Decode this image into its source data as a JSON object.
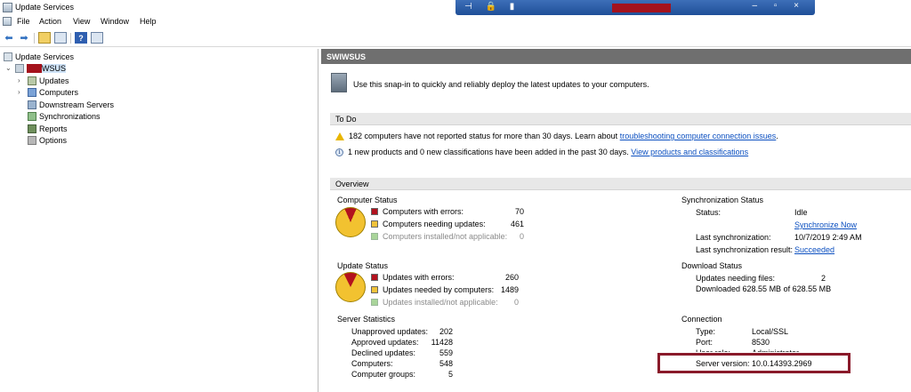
{
  "window": {
    "title": "Update Services"
  },
  "menu": [
    "File",
    "Action",
    "View",
    "Window",
    "Help"
  ],
  "tree": {
    "root": "Update Services",
    "server_suffix": "WSUS",
    "children": [
      "Updates",
      "Computers",
      "Downstream Servers",
      "Synchronizations",
      "Reports",
      "Options"
    ]
  },
  "main": {
    "header": "SWIWSUS",
    "intro": "Use this snap-in to quickly and reliably deploy the latest updates to your computers.",
    "todo": {
      "title": "To Do",
      "item1_text": "182 computers have not reported status for more than 30 days. Learn about",
      "item1_link": "troubleshooting computer connection issues",
      "item1_end": ".",
      "item2_text": "1 new products and 0 new classifications have been added in the past 30 days.",
      "item2_link": "View products and classifications"
    },
    "overview": {
      "title": "Overview",
      "computer_status": {
        "title": "Computer Status",
        "rows": [
          {
            "label": "Computers with errors:",
            "value": "70"
          },
          {
            "label": "Computers needing updates:",
            "value": "461"
          },
          {
            "label": "Computers installed/not applicable:",
            "value": "0"
          }
        ]
      },
      "update_status": {
        "title": "Update Status",
        "rows": [
          {
            "label": "Updates with errors:",
            "value": "260"
          },
          {
            "label": "Updates needed by computers:",
            "value": "1489"
          },
          {
            "label": "Updates installed/not applicable:",
            "value": "0"
          }
        ]
      },
      "server_statistics": {
        "title": "Server Statistics",
        "rows": [
          {
            "label": "Unapproved updates:",
            "value": "202"
          },
          {
            "label": "Approved updates:",
            "value": "11428"
          },
          {
            "label": "Declined updates:",
            "value": "559"
          },
          {
            "label": "Computers:",
            "value": "548"
          },
          {
            "label": "Computer groups:",
            "value": "5"
          }
        ]
      },
      "sync_status": {
        "title": "Synchronization Status",
        "status_label": "Status:",
        "status_value": "Idle",
        "sync_now": "Synchronize Now",
        "last_sync_label": "Last synchronization:",
        "last_sync_value": "10/7/2019 2:49 AM",
        "last_result_label": "Last synchronization result:",
        "last_result_value": "Succeeded"
      },
      "download_status": {
        "title": "Download Status",
        "files_label": "Updates needing files:",
        "files_value": "2",
        "downloaded": "Downloaded 628.55 MB of 628.55 MB"
      },
      "connection": {
        "title": "Connection",
        "type_label": "Type:",
        "type_value": "Local/SSL",
        "port_label": "Port:",
        "port_value": "8530",
        "user_label": "User role:",
        "user_value": "Administrator",
        "version_label": "Server version:",
        "version_value": "10.0.14393.2969"
      }
    }
  },
  "colors": {
    "error_red": "#b3121e",
    "pie_yellow": "#f2c230",
    "legend_yellow": "#f0c23a",
    "legend_green": "#a9d59a",
    "link_blue": "#0b4fc0",
    "highlight": "#8a1a2a"
  }
}
